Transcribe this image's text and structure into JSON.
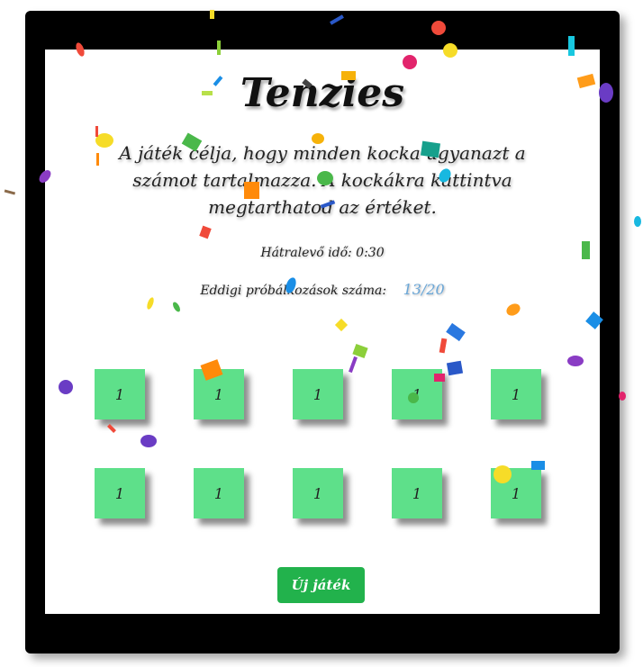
{
  "app": {
    "title": "Tenzies",
    "description": "A játék célja, hogy minden kocka ugyanazt a számot tartalmazza. A kockákra kattintva megtarthatod az értéket.",
    "timer_label": "Hátralevő idő: 0:30",
    "tries_label": "Eddigi próbálkozások száma:",
    "tries_value": "13/20",
    "new_game_label": "Új játék"
  },
  "dice": [
    {
      "value": "1"
    },
    {
      "value": "1"
    },
    {
      "value": "1"
    },
    {
      "value": "1"
    },
    {
      "value": "1"
    },
    {
      "value": "1"
    },
    {
      "value": "1"
    },
    {
      "value": "1"
    },
    {
      "value": "1"
    },
    {
      "value": "1"
    }
  ],
  "colors": {
    "die": "#5ee08a",
    "button": "#22b24c",
    "tries_count": "#6aa7d8",
    "frame": "#000000"
  }
}
